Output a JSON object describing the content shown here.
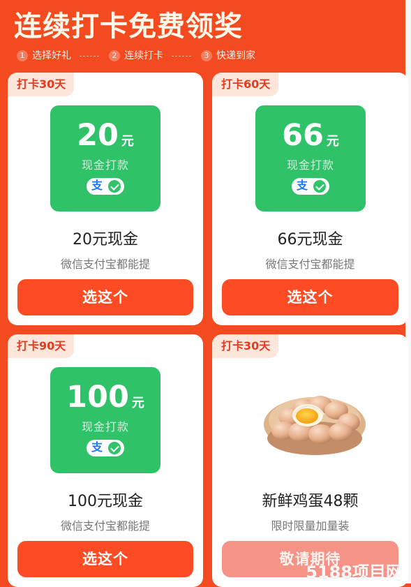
{
  "header": {
    "title": "连续打卡免费领奖",
    "steps": [
      {
        "num": "1",
        "label": "选择好礼"
      },
      {
        "num": "2",
        "label": "连续打卡"
      },
      {
        "num": "3",
        "label": "快递到家"
      }
    ]
  },
  "cards": [
    {
      "badge": "打卡30天",
      "amount": "20",
      "unit": "元",
      "subtitle": "现金打款",
      "pay_glyph": "支",
      "title": "20元现金",
      "description": "微信支付宝都能提",
      "button": "选这个"
    },
    {
      "badge": "打卡60天",
      "amount": "66",
      "unit": "元",
      "subtitle": "现金打款",
      "pay_glyph": "支",
      "title": "66元现金",
      "description": "微信支付宝都能提",
      "button": "选这个"
    },
    {
      "badge": "打卡90天",
      "amount": "100",
      "unit": "元",
      "subtitle": "现金打款",
      "pay_glyph": "支",
      "title": "100元现金",
      "description": "微信支付宝都能提",
      "button": "选这个"
    },
    {
      "badge": "打卡30天",
      "title": "新鲜鸡蛋48颗",
      "description": "限时限量加量装",
      "button": "敬请期待"
    }
  ],
  "watermark": "5188项目网",
  "colors": {
    "background": "#f34a1f",
    "card_background": "#ffffff",
    "badge_background": "#ffe6dd",
    "badge_text": "#e33b1d",
    "cash_tile": "#2fc269",
    "button_active": "#fd4b24",
    "button_disabled": "#f59386",
    "alipay_blue": "#1677ff"
  },
  "icons": [
    "alipay-icon",
    "verified-check-icon",
    "egg-basket-image"
  ]
}
